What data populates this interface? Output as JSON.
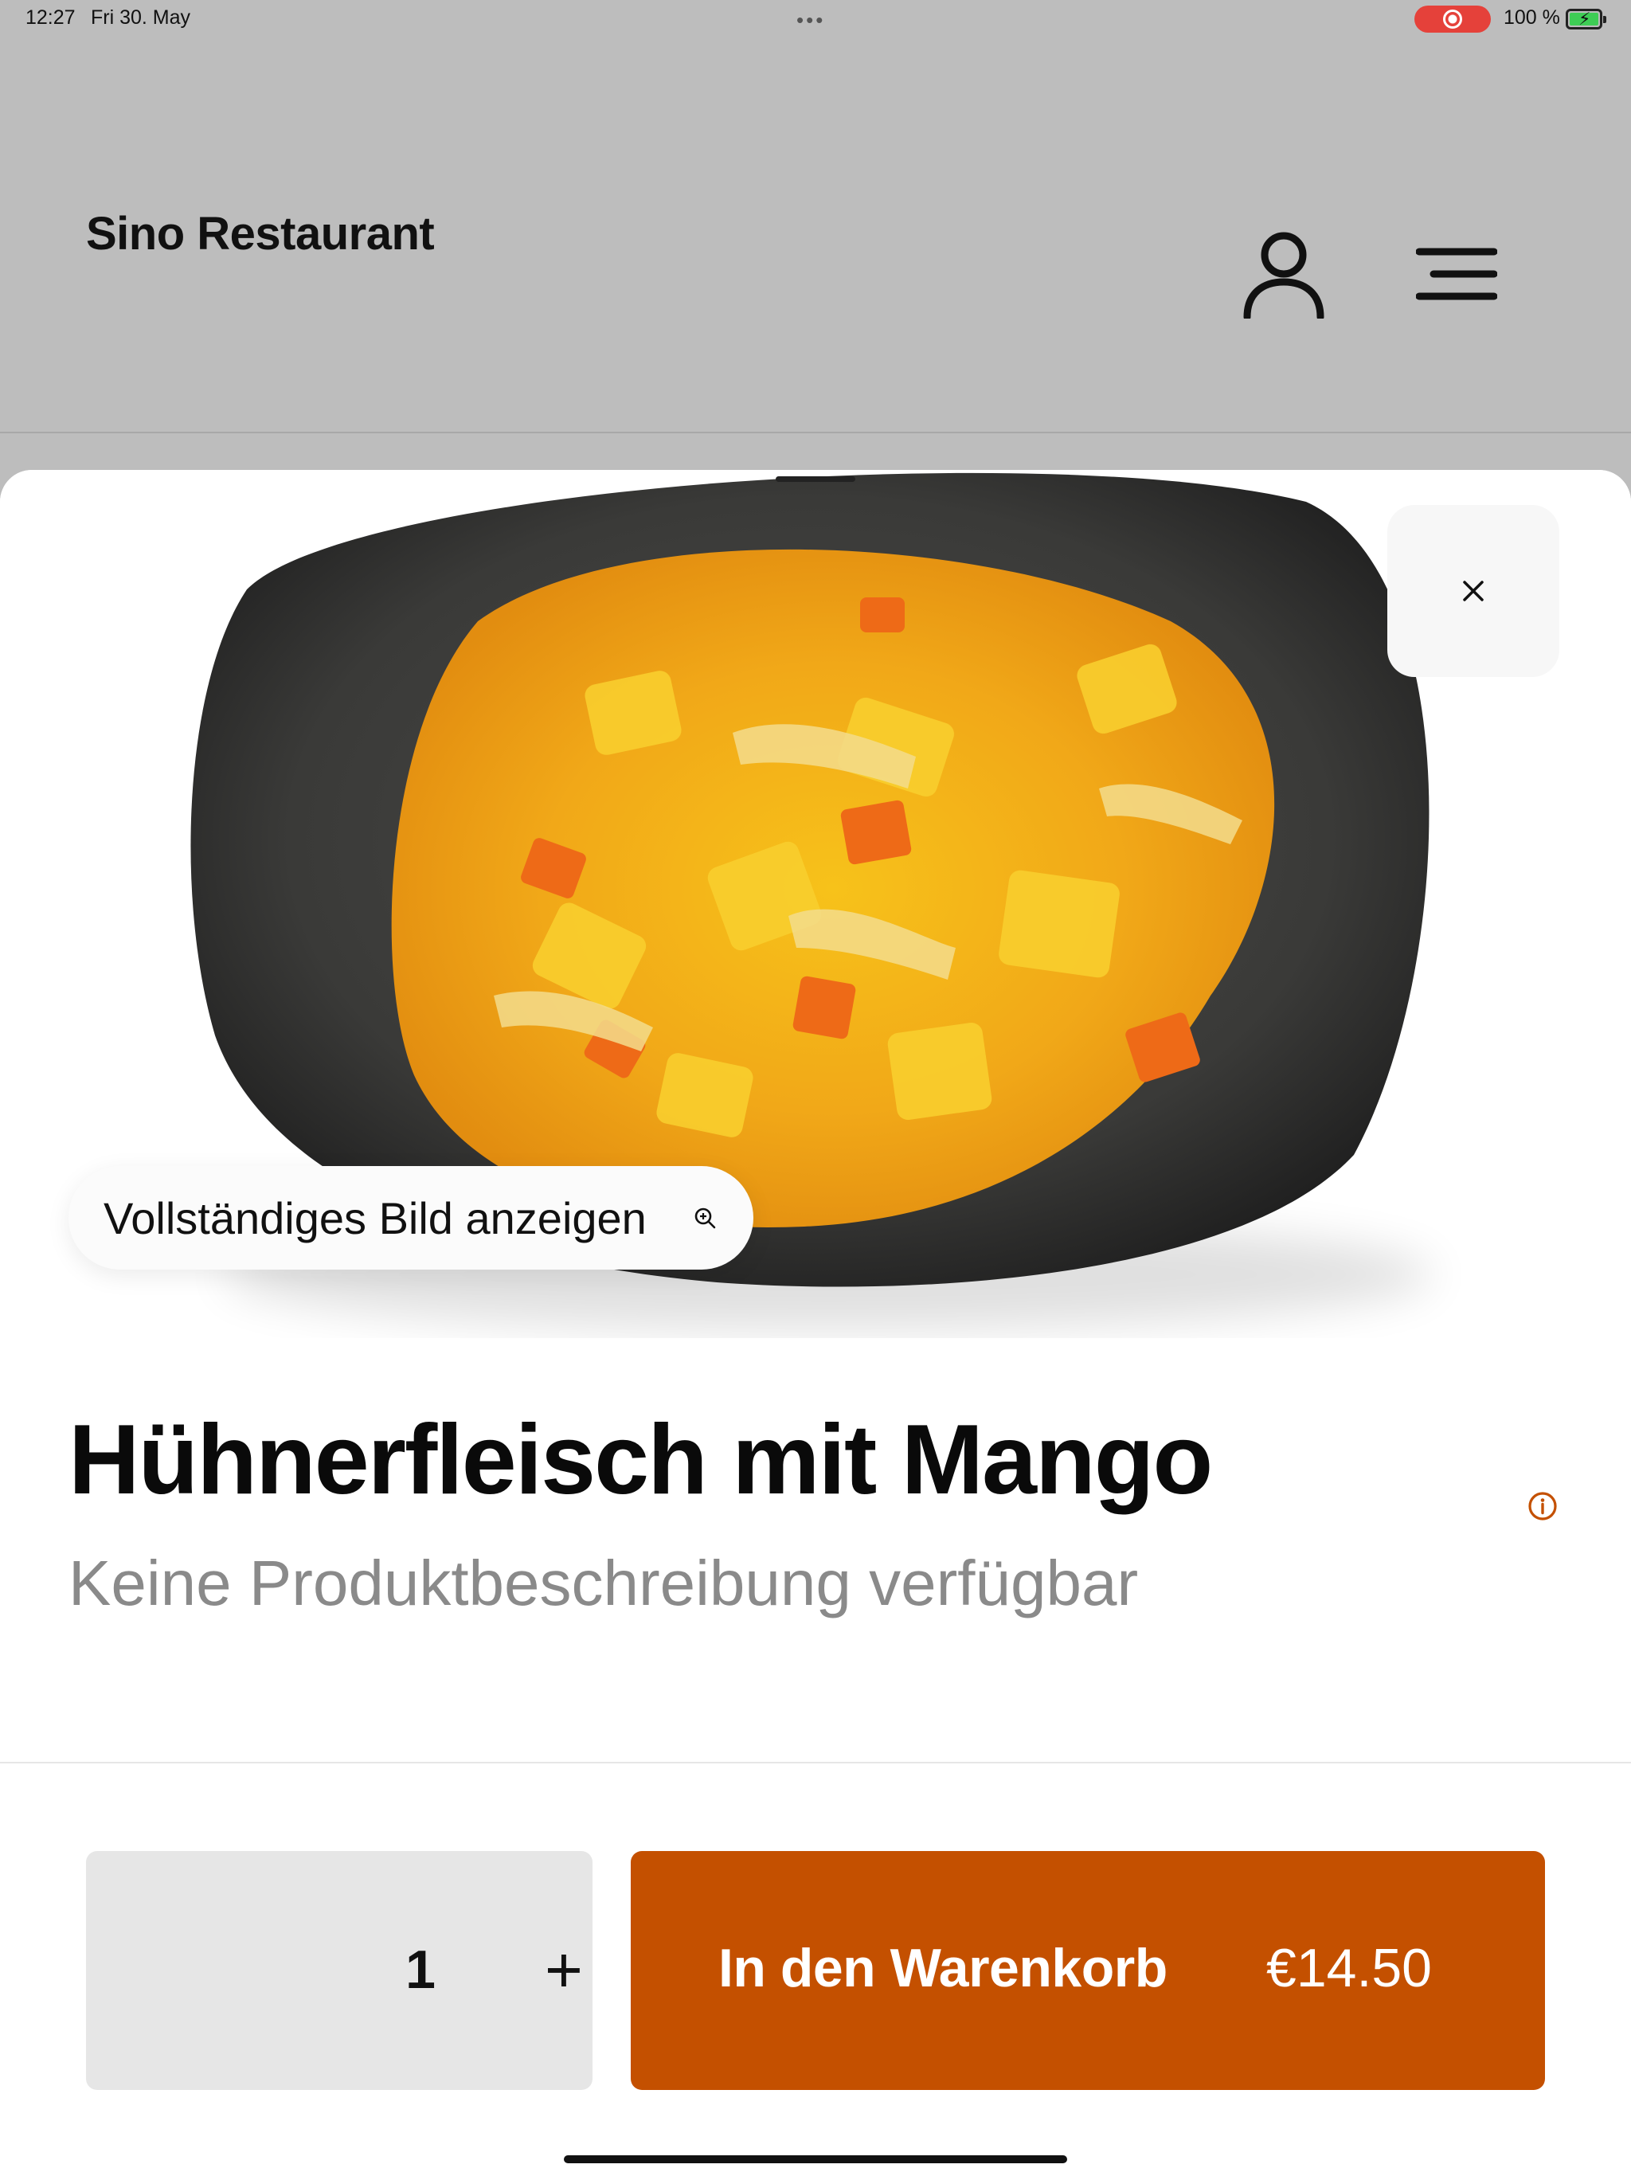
{
  "status_bar": {
    "time": "12:27",
    "date": "Fri 30. May",
    "battery_percent": "100 %",
    "battery_icon": "battery-charging-icon",
    "recording_icon": "screen-recording-icon",
    "multitask_icon": "more-dots-icon"
  },
  "header": {
    "brand": "Sino Restaurant",
    "account_icon": "user-icon",
    "menu_icon": "hamburger-menu-icon"
  },
  "product": {
    "image_icon": "dish-photo",
    "view_full_image_label": "Vollständiges Bild anzeigen",
    "zoom_icon": "zoom-in-icon",
    "close_icon": "close-icon",
    "title": "Hühnerfleisch mit Mango",
    "description": "Keine Produktbeschreibung verfügbar",
    "info_icon": "info-icon"
  },
  "order": {
    "quantity": "1",
    "increment_label": "+",
    "add_to_cart_label": "In den Warenkorb",
    "price": "€14.50"
  },
  "colors": {
    "accent": "#c45000",
    "info_icon": "#c45000",
    "header_bg": "#bdbdbd",
    "stepper_bg": "#e6e6e6"
  }
}
